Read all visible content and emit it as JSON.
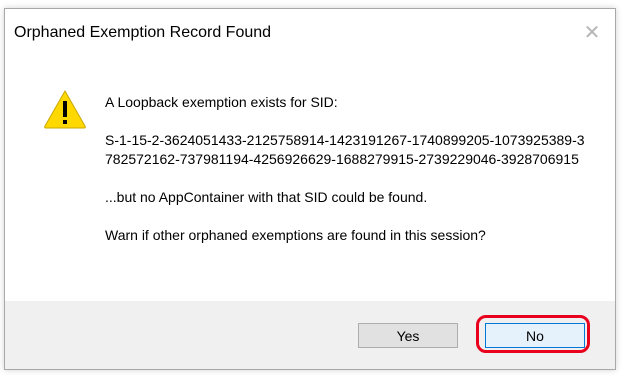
{
  "dialog": {
    "title": "Orphaned Exemption Record Found",
    "close_label": "✕"
  },
  "message": {
    "intro": "A Loopback exemption exists for SID:",
    "sid": "S-1-15-2-3624051433-2125758914-1423191267-1740899205-1073925389-3782572162-737981194-4256926629-1688279915-2739229046-3928706915",
    "not_found": "...but no AppContainer with that SID could be found.",
    "question": "Warn if other orphaned exemptions are found in this session?"
  },
  "icons": {
    "warning": "warning-icon",
    "close": "close-icon"
  },
  "buttons": {
    "yes_label": "Yes",
    "no_label": "No"
  },
  "colors": {
    "warning_fill": "#ffd800",
    "highlight": "#e8001c",
    "default_button_border": "#0078d7"
  }
}
